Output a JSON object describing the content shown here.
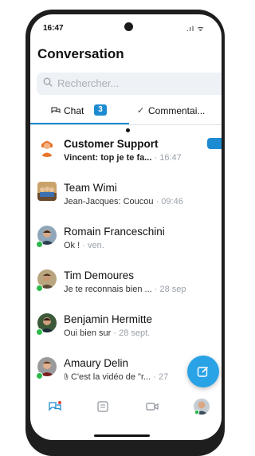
{
  "status_bar": {
    "time": "16:47",
    "icons": ".ıl ᯤ"
  },
  "header": {
    "title": "Conversation"
  },
  "search": {
    "placeholder": "Rechercher..."
  },
  "tabs": {
    "chat": {
      "label": "Chat",
      "badge": "3"
    },
    "comments": {
      "label": "Commentai..."
    }
  },
  "conversations": [
    {
      "name": "Customer Support",
      "preview": "Vincent: top je te fa...",
      "time": "16:47",
      "unread": true
    },
    {
      "name": "Team Wimi",
      "preview": "Jean-Jacques: Coucou",
      "time": "09:46",
      "unread": false
    },
    {
      "name": "Romain Franceschini",
      "preview": "Ok !",
      "time": "ven.",
      "unread": false
    },
    {
      "name": "Tim Demoures",
      "preview": "Je te reconnais bien ...",
      "time": "28 sep",
      "unread": false
    },
    {
      "name": "Benjamin Hermitte",
      "preview": "Oui bien sur",
      "time": "28 sept.",
      "unread": false
    },
    {
      "name": "Amaury Delin",
      "preview": "C'est la vidéo de \"r...",
      "time": "27",
      "unread": false
    }
  ],
  "separator": " · ",
  "colors": {
    "accent": "#1d8bd1",
    "fab": "#2aa2e6",
    "presence": "#2db84b",
    "search_bg": "#eef1f5"
  },
  "icons": [
    "search-icon",
    "chat-bubbles-icon",
    "check-icon",
    "attachment-icon",
    "compose-icon",
    "board-icon",
    "video-icon"
  ]
}
